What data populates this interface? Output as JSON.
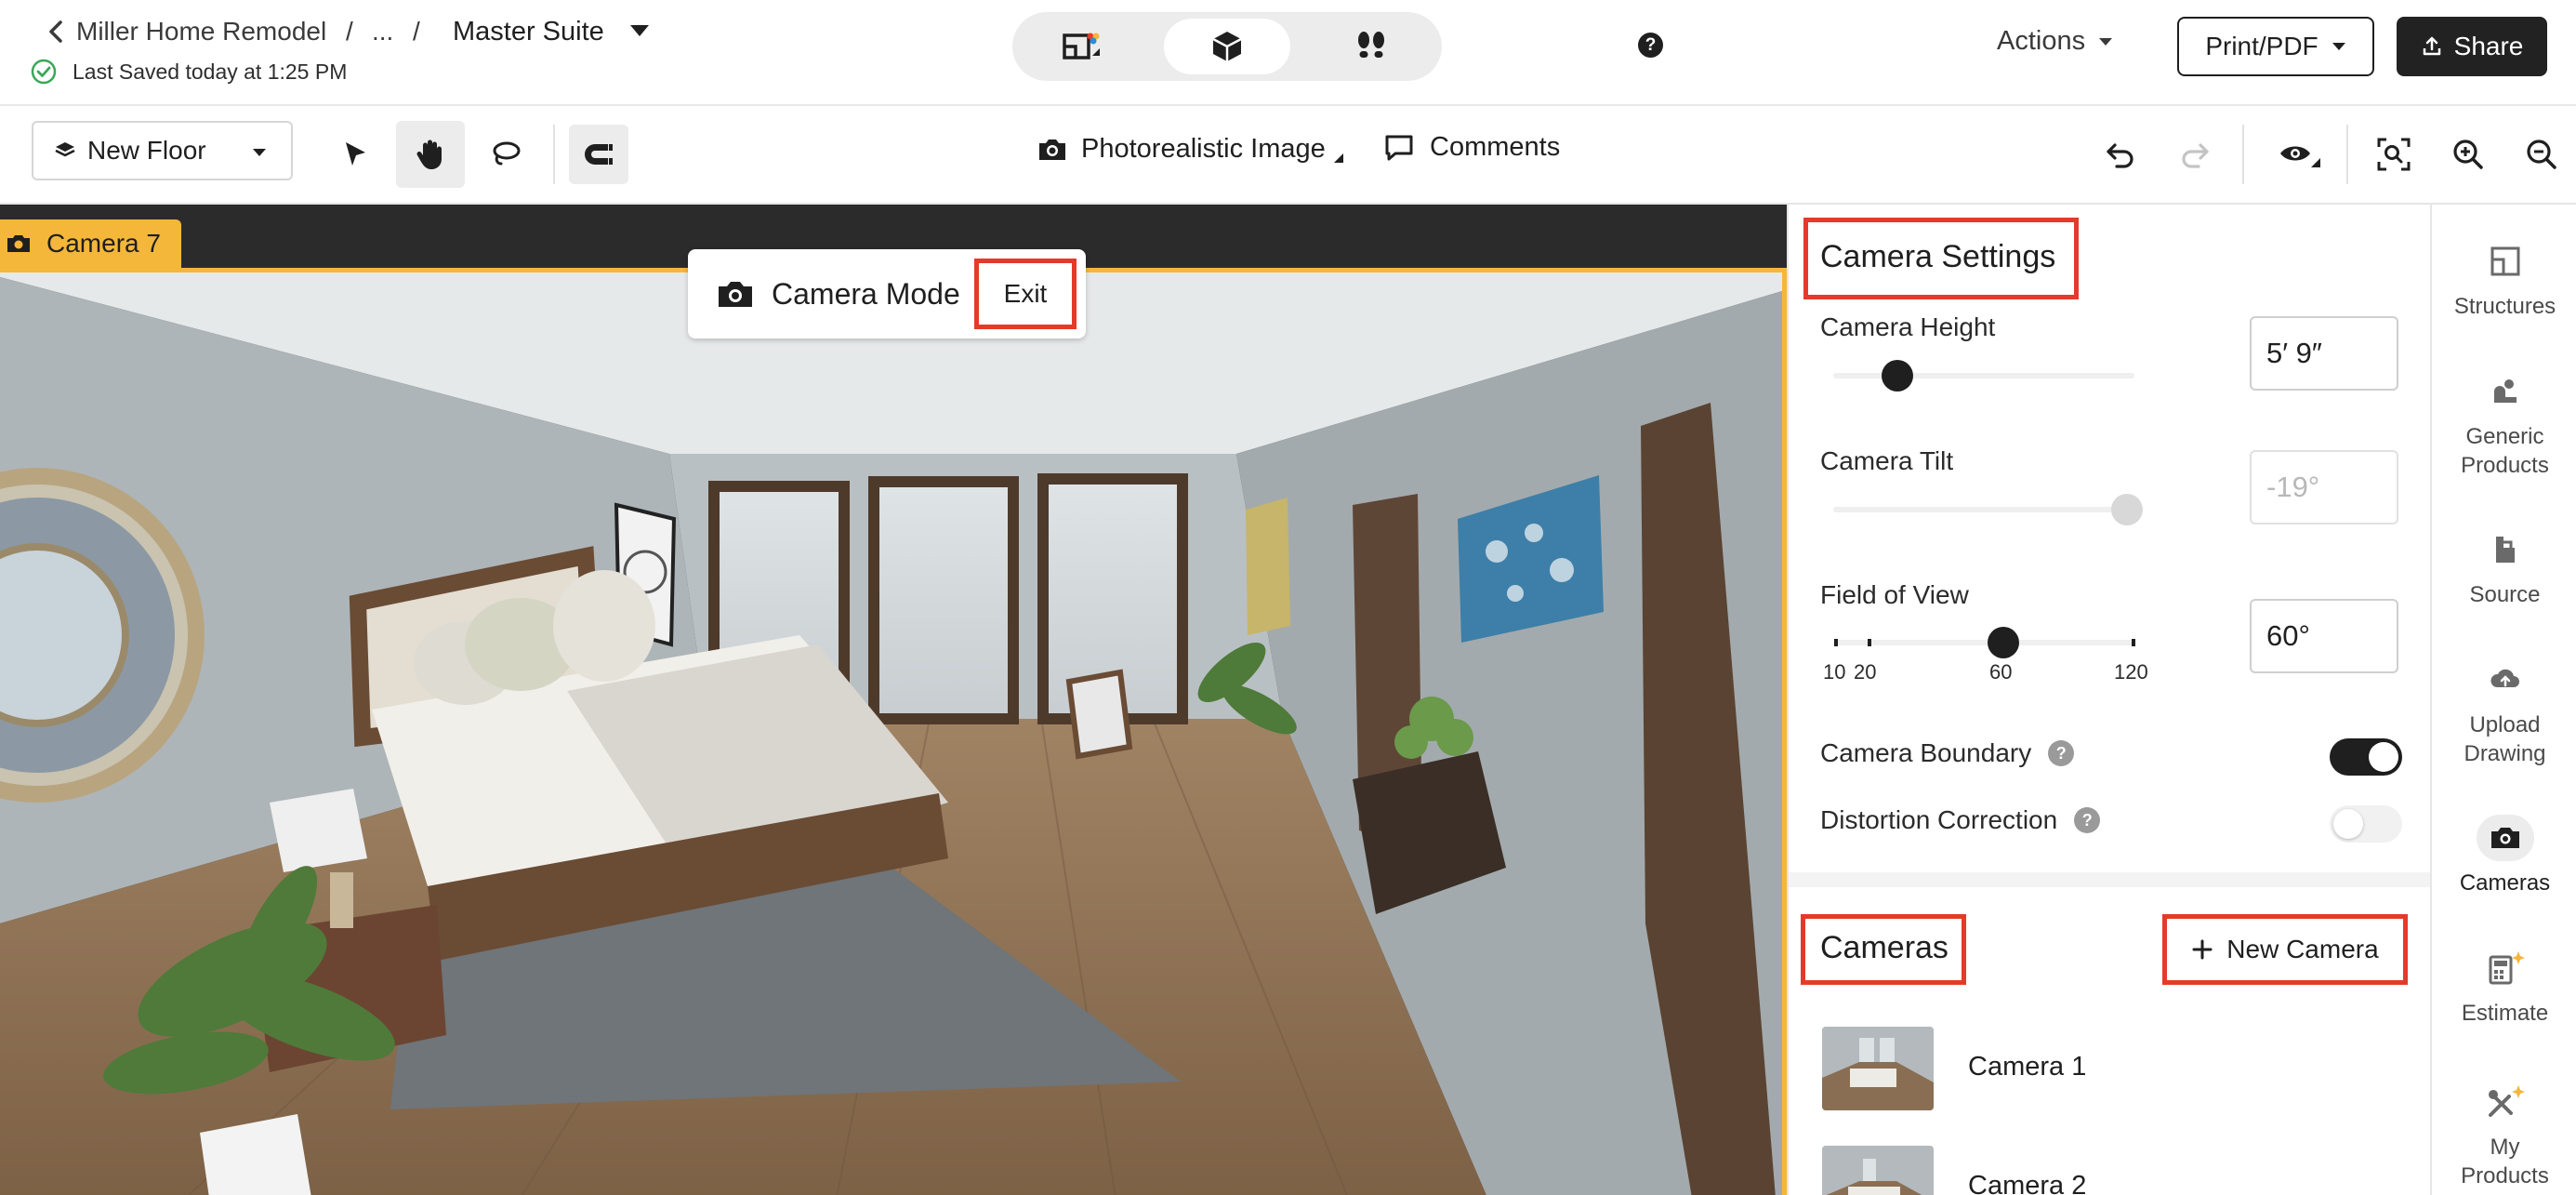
{
  "header": {
    "breadcrumb": {
      "project": "Miller Home Remodel",
      "ellipsis": "...",
      "separator": "/",
      "current": "Master Suite"
    },
    "saved_status": "Last Saved today at 1:25 PM",
    "help": "?",
    "actions_label": "Actions",
    "print_label": "Print/PDF",
    "share_label": "Share"
  },
  "toolbar": {
    "floor_label": "New Floor",
    "render_label": "Photorealistic Image",
    "comments_label": "Comments"
  },
  "viewport": {
    "camera_tag": "Camera 7",
    "mode_label": "Camera Mode",
    "exit_label": "Exit"
  },
  "settings": {
    "title": "Camera Settings",
    "height": {
      "label": "Camera Height",
      "value": "5′ 9″"
    },
    "tilt": {
      "label": "Camera Tilt",
      "value": "-19°"
    },
    "fov": {
      "label": "Field of View",
      "value": "60°",
      "ticks": [
        "10",
        "20",
        "60",
        "120"
      ]
    },
    "boundary": {
      "label": "Camera Boundary",
      "help": "?",
      "on": true
    },
    "distortion": {
      "label": "Distortion Correction",
      "help": "?",
      "on": false
    },
    "cameras_title": "Cameras",
    "new_camera_label": "New Camera",
    "cameras": [
      "Camera 1",
      "Camera 2"
    ]
  },
  "rail": {
    "items": [
      {
        "line1": "Structures",
        "line2": ""
      },
      {
        "line1": "Generic",
        "line2": "Products"
      },
      {
        "line1": "Source",
        "line2": ""
      },
      {
        "line1": "Upload",
        "line2": "Drawing"
      },
      {
        "line1": "Cameras",
        "line2": ""
      },
      {
        "line1": "Estimate",
        "line2": ""
      },
      {
        "line1": "My",
        "line2": "Products"
      }
    ]
  },
  "colors": {
    "accent_yellow": "#f4b73a",
    "highlight_red": "#e53a2a",
    "saved_green": "#3aa757",
    "dark": "#1f1f1f"
  }
}
